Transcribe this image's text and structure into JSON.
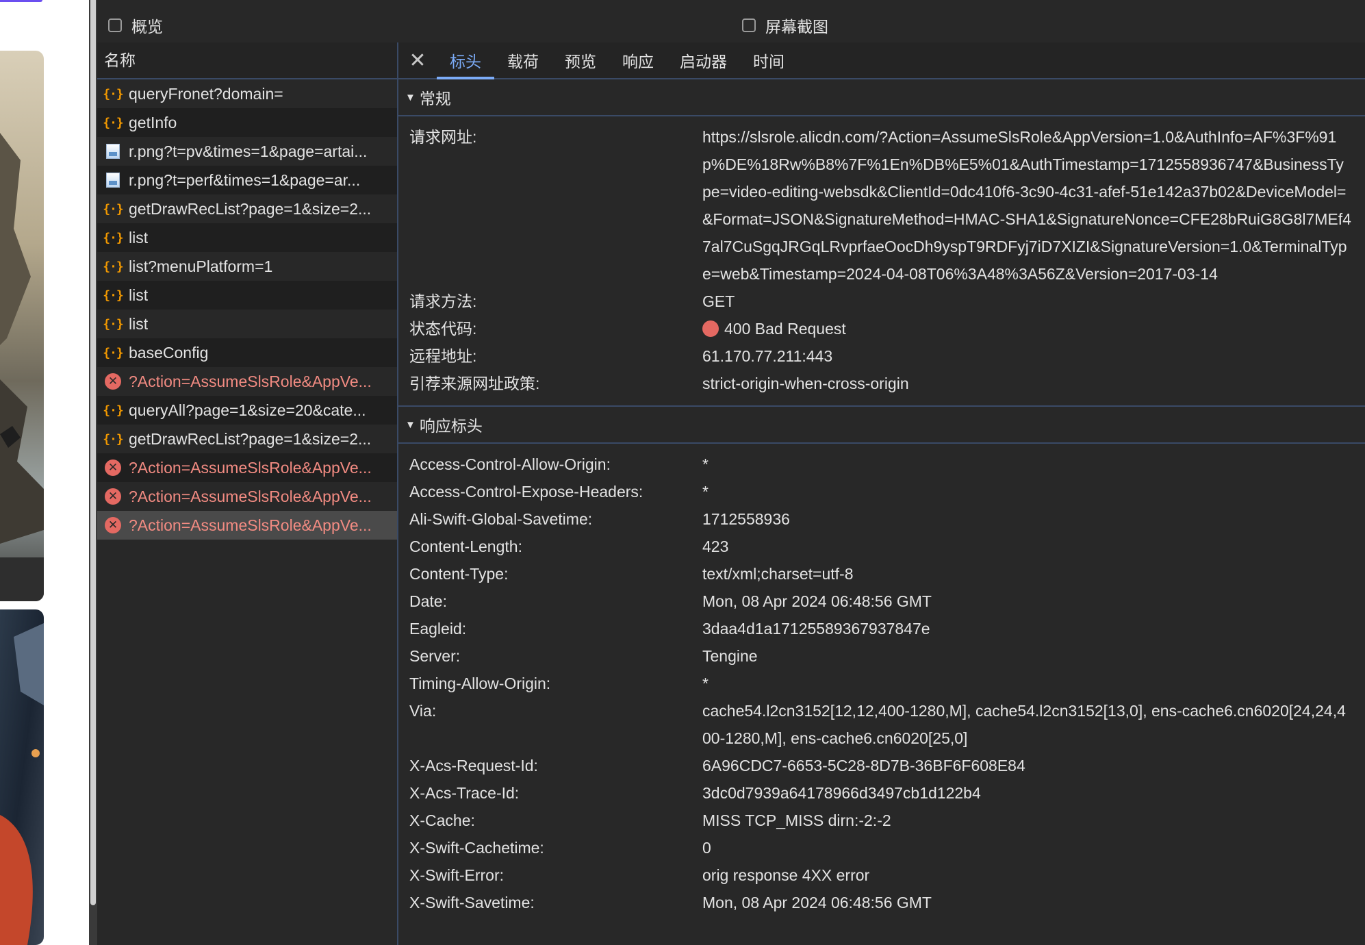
{
  "filters": {
    "overview_label": "概览",
    "screenshot_label": "屏幕截图"
  },
  "request_list": {
    "header": "名称",
    "rows": [
      {
        "name": "queryFronet?domain=",
        "type": "xhr",
        "error": false
      },
      {
        "name": "getInfo",
        "type": "xhr",
        "error": false
      },
      {
        "name": "r.png?t=pv&times=1&page=artai...",
        "type": "img",
        "error": false
      },
      {
        "name": "r.png?t=perf&times=1&page=ar...",
        "type": "img",
        "error": false
      },
      {
        "name": "getDrawRecList?page=1&size=2...",
        "type": "xhr",
        "error": false
      },
      {
        "name": "list",
        "type": "xhr",
        "error": false
      },
      {
        "name": "list?menuPlatform=1",
        "type": "xhr",
        "error": false
      },
      {
        "name": "list",
        "type": "xhr",
        "error": false
      },
      {
        "name": "list",
        "type": "xhr",
        "error": false
      },
      {
        "name": "baseConfig",
        "type": "xhr",
        "error": false
      },
      {
        "name": "?Action=AssumeSlsRole&AppVe...",
        "type": "error",
        "error": true
      },
      {
        "name": "queryAll?page=1&size=20&cate...",
        "type": "xhr",
        "error": false
      },
      {
        "name": "getDrawRecList?page=1&size=2...",
        "type": "xhr",
        "error": false
      },
      {
        "name": "?Action=AssumeSlsRole&AppVe...",
        "type": "error",
        "error": true
      },
      {
        "name": "?Action=AssumeSlsRole&AppVe...",
        "type": "error",
        "error": true
      },
      {
        "name": "?Action=AssumeSlsRole&AppVe...",
        "type": "error",
        "error": true,
        "selected": true
      }
    ]
  },
  "detail": {
    "tabs": [
      "标头",
      "载荷",
      "预览",
      "响应",
      "启动器",
      "时间"
    ],
    "active_tab": "标头",
    "general": {
      "title": "常规",
      "request_url_label": "请求网址:",
      "request_url": "https://slsrole.alicdn.com/?Action=AssumeSlsRole&AppVersion=1.0&AuthInfo=AF%3F%91p%DE%18Rw%B8%7F%1En%DB%E5%01&AuthTimestamp=1712558936747&BusinessType=video-editing-websdk&ClientId=0dc410f6-3c90-4c31-afef-51e142a37b02&DeviceModel=&Format=JSON&SignatureMethod=HMAC-SHA1&SignatureNonce=CFE28bRuiG8G8l7MEf47al7CuSgqJRGqLRvprfaeOocDh9yspT9RDFyj7iD7XIZI&SignatureVersion=1.0&TerminalType=web&Timestamp=2024-04-08T06%3A48%3A56Z&Version=2017-03-14",
      "method_label": "请求方法:",
      "method": "GET",
      "status_label": "状态代码:",
      "status": "400 Bad Request",
      "status_color": "#e46962",
      "remote_label": "远程地址:",
      "remote": "61.170.77.211:443",
      "referrer_label": "引荐来源网址政策:",
      "referrer": "strict-origin-when-cross-origin"
    },
    "response_headers": {
      "title": "响应标头",
      "items": [
        {
          "k": "Access-Control-Allow-Origin:",
          "v": "*"
        },
        {
          "k": "Access-Control-Expose-Headers:",
          "v": "*"
        },
        {
          "k": "Ali-Swift-Global-Savetime:",
          "v": "1712558936"
        },
        {
          "k": "Content-Length:",
          "v": "423"
        },
        {
          "k": "Content-Type:",
          "v": "text/xml;charset=utf-8"
        },
        {
          "k": "Date:",
          "v": "Mon, 08 Apr 2024 06:48:56 GMT"
        },
        {
          "k": "Eagleid:",
          "v": "3daa4d1a17125589367937847e"
        },
        {
          "k": "Server:",
          "v": "Tengine"
        },
        {
          "k": "Timing-Allow-Origin:",
          "v": "*"
        },
        {
          "k": "Via:",
          "v": "cache54.l2cn3152[12,12,400-1280,M], cache54.l2cn3152[13,0], ens-cache6.cn6020[24,24,400-1280,M], ens-cache6.cn6020[25,0]"
        },
        {
          "k": "X-Acs-Request-Id:",
          "v": "6A96CDC7-6653-5C28-8D7B-36BF6F608E84"
        },
        {
          "k": "X-Acs-Trace-Id:",
          "v": "3dc0d7939a64178966d3497cb1d122b4"
        },
        {
          "k": "X-Cache:",
          "v": "MISS TCP_MISS dirn:-2:-2"
        },
        {
          "k": "X-Swift-Cachetime:",
          "v": "0"
        },
        {
          "k": "X-Swift-Error:",
          "v": "orig response 4XX error"
        },
        {
          "k": "X-Swift-Savetime:",
          "v": "Mon, 08 Apr 2024 06:48:56 GMT"
        }
      ]
    }
  }
}
